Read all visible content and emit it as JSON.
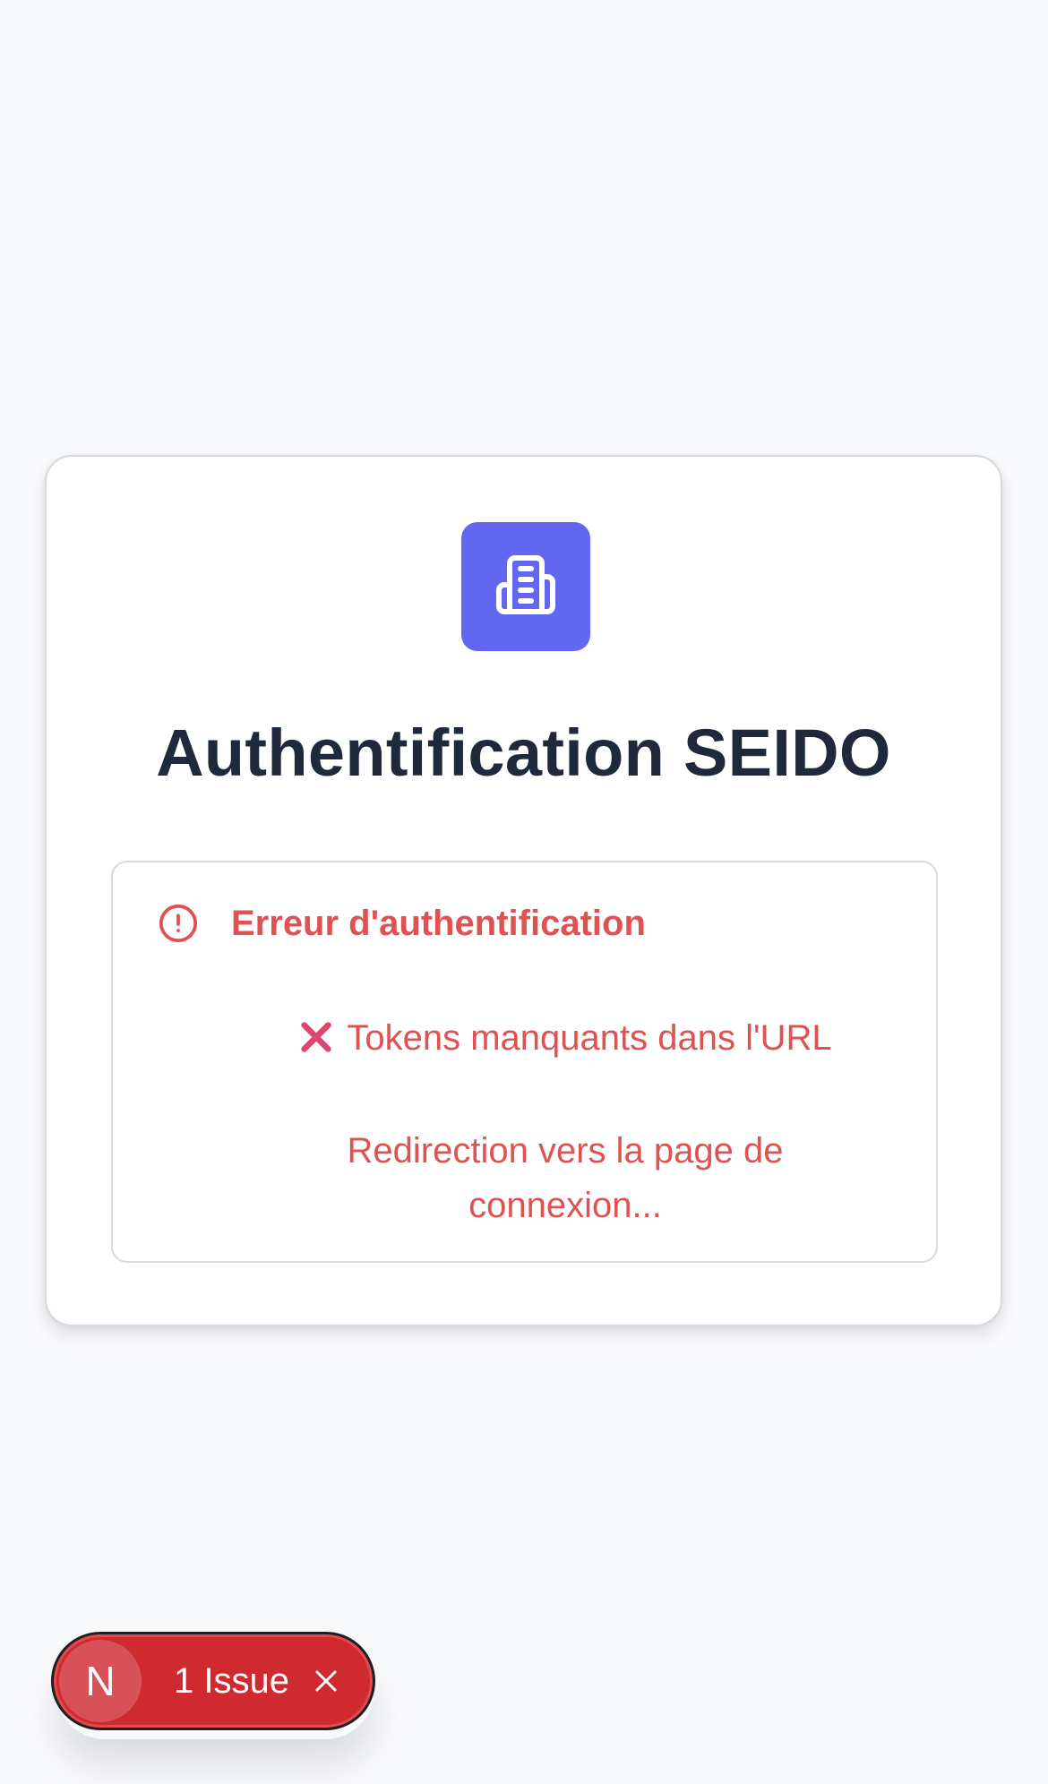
{
  "app": {
    "title": "Authentification SEIDO",
    "logo_icon": "building-icon",
    "brand_color": "#6366f1"
  },
  "alert": {
    "icon": "alert-circle-icon",
    "title": "Erreur d'authentification",
    "message_icon": "cross-mark-icon",
    "message": "Tokens manquants dans l'URL",
    "redirect": "Redirection vers la page de connexion...",
    "color": "#e05252"
  },
  "dev_overlay": {
    "logo_letter": "N",
    "issues_label": "1 Issue",
    "close_icon": "close-icon",
    "color": "#cf2a30"
  }
}
